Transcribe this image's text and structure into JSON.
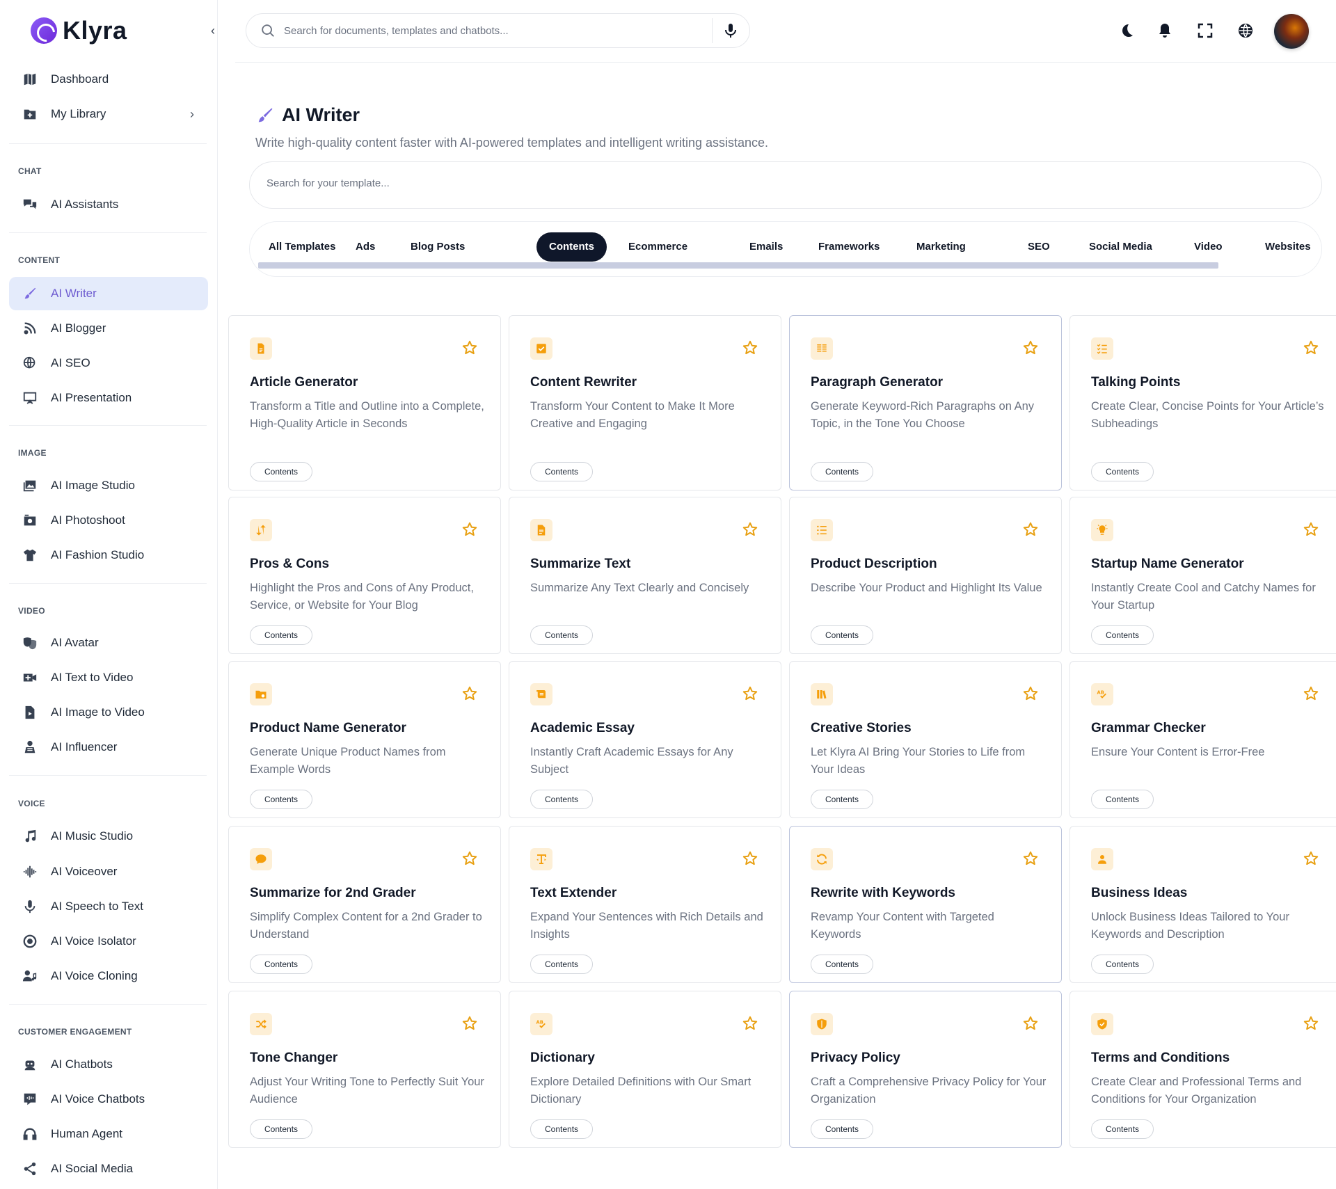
{
  "app": {
    "name": "Klyra"
  },
  "topbar": {
    "search_placeholder": "Search for documents, templates and chatbots...",
    "icons": [
      "moon-icon",
      "bell-icon",
      "fullscreen-icon",
      "globe-icon"
    ]
  },
  "sidebar": {
    "top_items": [
      {
        "label": "Dashboard",
        "icon": "map-icon"
      },
      {
        "label": "My Library",
        "icon": "folder-plus-icon"
      }
    ],
    "sections": {
      "chat": "CHAT",
      "content": "CONTENT",
      "image": "IMAGE",
      "video": "VIDEO",
      "voice": "VOICE",
      "engagement": "CUSTOMER ENGAGEMENT"
    },
    "chat_items": [
      {
        "label": "AI Assistants"
      }
    ],
    "content_items": [
      {
        "label": "AI Writer"
      },
      {
        "label": "AI Blogger"
      },
      {
        "label": "AI SEO"
      },
      {
        "label": "AI Presentation"
      }
    ],
    "image_items": [
      {
        "label": "AI Image Studio"
      },
      {
        "label": "AI Photoshoot"
      },
      {
        "label": "AI Fashion Studio"
      }
    ],
    "video_items": [
      {
        "label": "AI Avatar"
      },
      {
        "label": "AI Text to Video"
      },
      {
        "label": "AI Image to Video"
      },
      {
        "label": "AI Influencer"
      }
    ],
    "voice_items": [
      {
        "label": "AI Music Studio"
      },
      {
        "label": "AI Voiceover"
      },
      {
        "label": "AI Speech to Text"
      },
      {
        "label": "AI Voice Isolator"
      },
      {
        "label": "AI Voice Cloning"
      }
    ],
    "engagement_items": [
      {
        "label": "AI Chatbots"
      },
      {
        "label": "AI Voice Chatbots"
      },
      {
        "label": "Human Agent"
      },
      {
        "label": "AI Social Media"
      }
    ]
  },
  "header": {
    "title": "AI Writer",
    "subtitle": "Write high-quality content faster with AI-powered templates and intelligent writing assistance.",
    "template_search_placeholder": "Search for your template..."
  },
  "tabs": [
    "All Templates",
    "Ads",
    "Blog Posts",
    "Contents",
    "Ecommerce",
    "Emails",
    "Frameworks",
    "Marketing",
    "SEO",
    "Social Media",
    "Video",
    "Websites"
  ],
  "active_tab": "Contents",
  "colors": {
    "accent": "#7c6be0",
    "icon_orange": "#f59e0b",
    "icon_bg": "#fdefd6",
    "active_bg": "#e4ebfb"
  },
  "cards": [
    {
      "title": "Article Generator",
      "desc": "Transform a Title and Outline into a Complete, High-Quality Article in Seconds",
      "tag": "Contents",
      "icon": "document-icon"
    },
    {
      "title": "Content Rewriter",
      "desc": "Transform Your Content to Make It More Creative and Engaging",
      "tag": "Contents",
      "icon": "check-square-icon"
    },
    {
      "title": "Paragraph Generator",
      "desc": "Generate Keyword-Rich Paragraphs on Any Topic, in the Tone You Choose",
      "tag": "Contents",
      "icon": "paragraph-icon"
    },
    {
      "title": "Talking Points",
      "desc": "Create Clear, Concise Points for Your Article’s Subheadings",
      "tag": "Contents",
      "icon": "checklist-icon"
    },
    {
      "title": "Pros & Cons",
      "desc": "Highlight the Pros and Cons of Any Product, Service, or Website for Your Blog",
      "tag": "Contents",
      "icon": "swap-icon"
    },
    {
      "title": "Summarize Text",
      "desc": "Summarize Any Text Clearly and Concisely",
      "tag": "Contents",
      "icon": "document-text-icon"
    },
    {
      "title": "Product Description",
      "desc": "Describe Your Product and Highlight Its Value",
      "tag": "Contents",
      "icon": "list-icon"
    },
    {
      "title": "Startup Name Generator",
      "desc": "Instantly Create Cool and Catchy Names for Your Startup",
      "tag": "Contents",
      "icon": "lightbulb-icon"
    },
    {
      "title": "Product Name Generator",
      "desc": "Generate Unique Product Names from Example Words",
      "tag": "Contents",
      "icon": "folder-settings-icon"
    },
    {
      "title": "Academic Essay",
      "desc": "Instantly Craft Academic Essays for Any Subject",
      "tag": "Contents",
      "icon": "scroll-icon"
    },
    {
      "title": "Creative Stories",
      "desc": "Let Klyra AI Bring Your Stories to Life from Your Ideas",
      "tag": "Contents",
      "icon": "books-icon"
    },
    {
      "title": "Grammar Checker",
      "desc": "Ensure Your Content is Error-Free",
      "tag": "Contents",
      "icon": "spellcheck-icon"
    },
    {
      "title": "Summarize for 2nd Grader",
      "desc": "Simplify Complex Content for a 2nd Grader to Understand",
      "tag": "Contents",
      "icon": "speech-bubble-icon"
    },
    {
      "title": "Text Extender",
      "desc": "Expand Your Sentences with Rich Details and Insights",
      "tag": "Contents",
      "icon": "text-expand-icon"
    },
    {
      "title": "Rewrite with Keywords",
      "desc": "Revamp Your Content with Targeted Keywords",
      "tag": "Contents",
      "icon": "refresh-icon"
    },
    {
      "title": "Business Ideas",
      "desc": "Unlock Business Ideas Tailored to Your Keywords and Description",
      "tag": "Contents",
      "icon": "user-badge-icon"
    },
    {
      "title": "Tone Changer",
      "desc": "Adjust Your Writing Tone to Perfectly Suit Your Audience",
      "tag": "Contents",
      "icon": "shuffle-icon"
    },
    {
      "title": "Dictionary",
      "desc": "Explore Detailed Definitions with Our Smart Dictionary",
      "tag": "Contents",
      "icon": "spellcheck-icon"
    },
    {
      "title": "Privacy Policy",
      "desc": "Craft a Comprehensive Privacy Policy for Your Organization",
      "tag": "Contents",
      "icon": "shield-icon"
    },
    {
      "title": "Terms and Conditions",
      "desc": "Create Clear and Professional Terms and Conditions for Your Organization",
      "tag": "Contents",
      "icon": "shield-check-icon"
    }
  ]
}
